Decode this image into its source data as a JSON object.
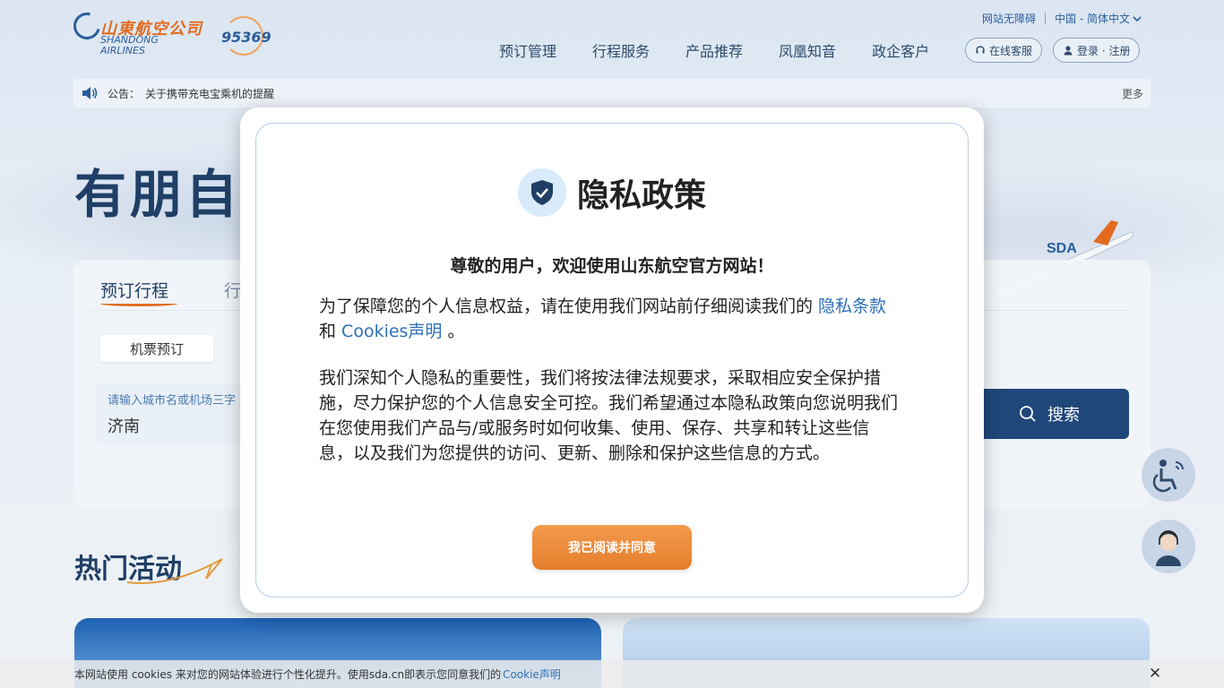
{
  "header": {
    "logo_cn": "山東航空公司",
    "logo_en_line1": "SHANDONG",
    "logo_en_line2": "AIRLINES",
    "hotline": "95369",
    "accessibility_link": "网站无障碍",
    "language": "中国 - 简体中文",
    "nav": [
      "预订管理",
      "行程服务",
      "产品推荐",
      "凤凰知音",
      "政企客户"
    ],
    "service_button": "在线客服",
    "login_button": "登录 · 注册"
  },
  "notice": {
    "label": "公告：",
    "text": "关于携带充电宝乘机的提醒",
    "more": "更多"
  },
  "hero": {
    "title": "有朋自"
  },
  "booking": {
    "tab_active": "预订行程",
    "tab_next": "行",
    "flight_button": "机票预订",
    "city_hint": "请输入城市名或机场三字",
    "city_value": "济南",
    "search_button": "搜索"
  },
  "hot": {
    "title": "热门活动"
  },
  "modal": {
    "title": "隐私政策",
    "greeting": "尊敬的用户，欢迎使用山东航空官方网站！",
    "para1_prefix": "为了保障您的个人信息权益，请在使用我们网站前仔细阅读我们的 ",
    "privacy_link": "隐私条款",
    "para1_and": " 和 ",
    "cookies_link": "Cookies声明",
    "para1_suffix": " 。",
    "para2": "我们深知个人隐私的重要性，我们将按法律法规要求，采取相应安全保护措施，尽力保护您的个人信息安全可控。我们希望通过本隐私政策向您说明我们在您使用我们产品与/或服务时如何收集、使用、保存、共享和转让这些信息，以及我们为您提供的访问、更新、删除和保护这些信息的方式。",
    "agree_button": "我已阅读并同意"
  },
  "cookie_bar": {
    "text": "本网站使用 cookies 来对您的网站体验进行个性化提升。使用sda.cn即表示您同意我们的",
    "link": "Cookie声明",
    "close": "✕"
  },
  "colors": {
    "brand_blue": "#20477a",
    "brand_orange": "#e57e2c",
    "link_blue": "#2d6fb7"
  }
}
